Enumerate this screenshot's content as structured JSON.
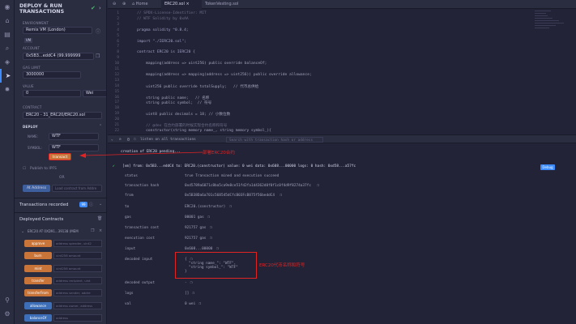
{
  "panel": {
    "title": "DEPLOY & RUN TRANSACTIONS",
    "environment_label": "ENVIRONMENT",
    "environment_value": "Remix VM (London)",
    "vm_badge": "VM",
    "account_label": "ACCOUNT",
    "account_value": "0x5B3...eddC4 (99.999999",
    "gas_limit_label": "GAS LIMIT",
    "gas_limit_value": "3000000",
    "value_label": "VALUE",
    "value_value": "0",
    "value_unit": "Wei",
    "contract_label": "CONTRACT",
    "contract_value": "ERC20 - 31_ERC20/ERC20.sol",
    "deploy_label": "DEPLOY",
    "name_label": "NAME:",
    "name_value": "WTF",
    "symbol_label": "SYMBOL:",
    "symbol_value": "WTF",
    "transact_button": "transact",
    "publish_ipfs": "Publish to IPFS",
    "or_label": "OR",
    "at_address_button": "At Address",
    "load_contract_placeholder": "Load contract from Addre",
    "transactions_recorded": "Transactions recorded",
    "transactions_count": "99",
    "deployed_contracts": "Deployed Contracts",
    "deployed_item": "ERC20 AT 0XD91...39138 (MEM",
    "functions": [
      {
        "name": "approve",
        "arg": "address spender, uint2"
      },
      {
        "name": "burn",
        "arg": "uint256 amount"
      },
      {
        "name": "mint",
        "arg": "uint256 amount"
      },
      {
        "name": "transfer",
        "arg": "address recipient, uint"
      },
      {
        "name": "transferFrom",
        "arg": "address sender, addre"
      },
      {
        "name": "allowance",
        "arg": "address owner, address"
      },
      {
        "name": "balanceOf",
        "arg": "address"
      }
    ]
  },
  "tabs": [
    "Home",
    "ERC20.sol",
    "TokenVesting.sol"
  ],
  "editor": {
    "lines": [
      {
        "n": "1",
        "t": "// SPDX-License-Identifier: MIT"
      },
      {
        "n": "2",
        "t": "// WTF Solidity by 0xAA"
      },
      {
        "n": "3",
        "t": ""
      },
      {
        "n": "4",
        "t": "pragma solidity ^0.8.4;"
      },
      {
        "n": "5",
        "t": ""
      },
      {
        "n": "6",
        "t": "import \"./IERC20.sol\";"
      },
      {
        "n": "7",
        "t": ""
      },
      {
        "n": "8",
        "t": "contract ERC20 is IERC20 {"
      },
      {
        "n": "9",
        "t": ""
      },
      {
        "n": "10",
        "t": "    mapping(address => uint256) public override balanceOf;"
      },
      {
        "n": "11",
        "t": ""
      },
      {
        "n": "12",
        "t": "    mapping(address => mapping(address => uint256)) public override allowance;"
      },
      {
        "n": "13",
        "t": ""
      },
      {
        "n": "14",
        "t": "    uint256 public override totalSupply;   // 代币总供给"
      },
      {
        "n": "15",
        "t": ""
      },
      {
        "n": "16",
        "t": "    string public name;   // 名称"
      },
      {
        "n": "17",
        "t": "    string public symbol;  // 符号"
      },
      {
        "n": "18",
        "t": ""
      },
      {
        "n": "19",
        "t": "    uint8 public decimals = 18; // 小数位数"
      },
      {
        "n": "20",
        "t": ""
      },
      {
        "n": "21",
        "t": "    // @dev 在合约部署的时候实现合约名称和符号"
      },
      {
        "n": "22",
        "t": "    constructor(string memory name_, string memory symbol_){"
      }
    ]
  },
  "terminal": {
    "listen_label": "listen on all transactions",
    "search_placeholder": "Search with transaction hash or address",
    "pending": "creation of ERC20 pending...",
    "tx_summary": "[vm] from: 0x5B3...eddC4 to: ERC20.(constructor) value: 0 wei data: 0x608...00000 logs: 0 hash: 0xd58...a57fc",
    "debug_button": "Debug",
    "rows": [
      {
        "k": "status",
        "v": "true Transaction mined and execution succeed"
      },
      {
        "k": "transaction hash",
        "v": "0xd5789a6071c8ba5ca9e8ce51fd2fa1d4362d0f0f1c0f4d9f8274a37fc"
      },
      {
        "k": "from",
        "v": "0x5B38Da6a701c568545dCfcB03FcB875f56beddC4"
      },
      {
        "k": "to",
        "v": "ERC20.(constructor)"
      },
      {
        "k": "gas",
        "v": "00001 gas"
      },
      {
        "k": "transaction cost",
        "v": "921757 gas"
      },
      {
        "k": "execution cost",
        "v": "921757 gas"
      },
      {
        "k": "input",
        "v": "0x608...00000"
      },
      {
        "k": "decoded input",
        "v": "{"
      },
      {
        "k": "decoded output",
        "v": "-"
      },
      {
        "k": "logs",
        "v": "[]"
      },
      {
        "k": "val",
        "v": "0 wei"
      }
    ],
    "decoded_input_lines": [
      "\"string name_\": \"WTF\",",
      "\"string symbol_\": \"WTF\""
    ],
    "decoded_close": "}"
  },
  "annotations": {
    "deploy_note": "部署ERC20合约",
    "args_note": "ERC20代币名称和符号"
  },
  "colors": {
    "accent": "#c97539",
    "annotation": "#e02424",
    "success": "#3fbf63",
    "bg": "#222336"
  }
}
